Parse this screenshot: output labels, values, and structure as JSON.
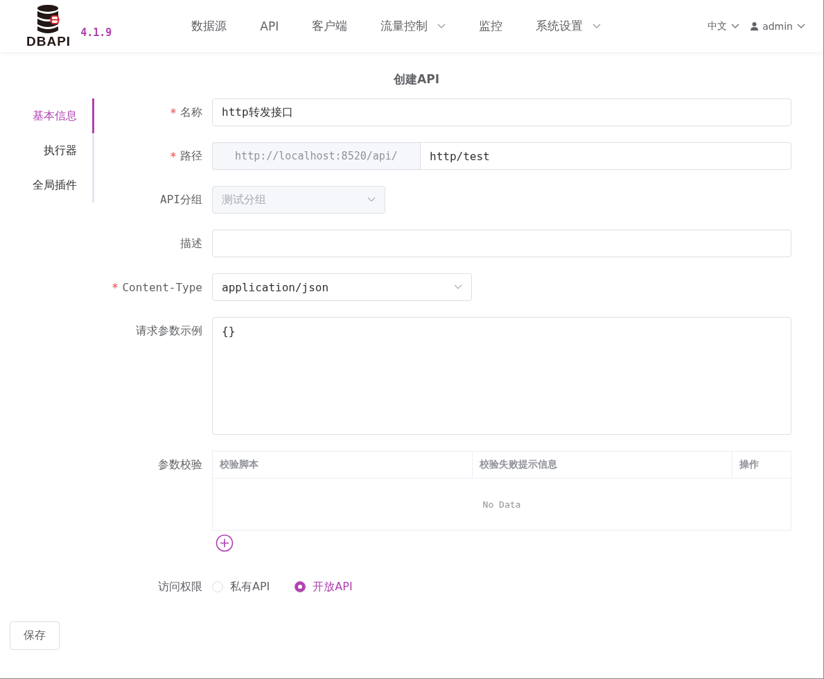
{
  "header": {
    "logo": "DBAPI",
    "version": "4.1.9",
    "nav": [
      {
        "label": "数据源",
        "dropdown": false
      },
      {
        "label": "API",
        "dropdown": false
      },
      {
        "label": "客户端",
        "dropdown": false
      },
      {
        "label": "流量控制",
        "dropdown": true
      },
      {
        "label": "监控",
        "dropdown": false
      },
      {
        "label": "系统设置",
        "dropdown": true
      }
    ],
    "language": "中文",
    "user": "admin"
  },
  "page_title": "创建API",
  "side_tabs": [
    {
      "label": "基本信息",
      "selected": true
    },
    {
      "label": "执行器",
      "selected": false
    },
    {
      "label": "全局插件",
      "selected": false
    }
  ],
  "fields": [
    {
      "kind": "text",
      "label": "名称",
      "required": true,
      "value": "http转发接口"
    },
    {
      "kind": "path",
      "label": "路径",
      "required": true,
      "prefix": "http://localhost:8520/api/",
      "value": "http/test"
    },
    {
      "kind": "select",
      "label": "API分组",
      "required": false,
      "disabled": true,
      "value": "测试分组"
    },
    {
      "kind": "text",
      "label": "描述",
      "required": false
    },
    {
      "kind": "select",
      "label": "Content-Type",
      "required": true,
      "disabled": false,
      "value": "application/json"
    },
    {
      "kind": "textarea",
      "label": "请求参数示例",
      "required": false,
      "value": "{}"
    }
  ],
  "validation": {
    "label": "参数校验",
    "columns": [
      "校验脚本",
      "校验失败提示信息",
      "操作"
    ],
    "empty_text": "No Data"
  },
  "access": {
    "label": "访问权限",
    "options": [
      {
        "label": "私有API",
        "selected": false
      },
      {
        "label": "开放API",
        "selected": true
      }
    ]
  },
  "save_button": "保存"
}
